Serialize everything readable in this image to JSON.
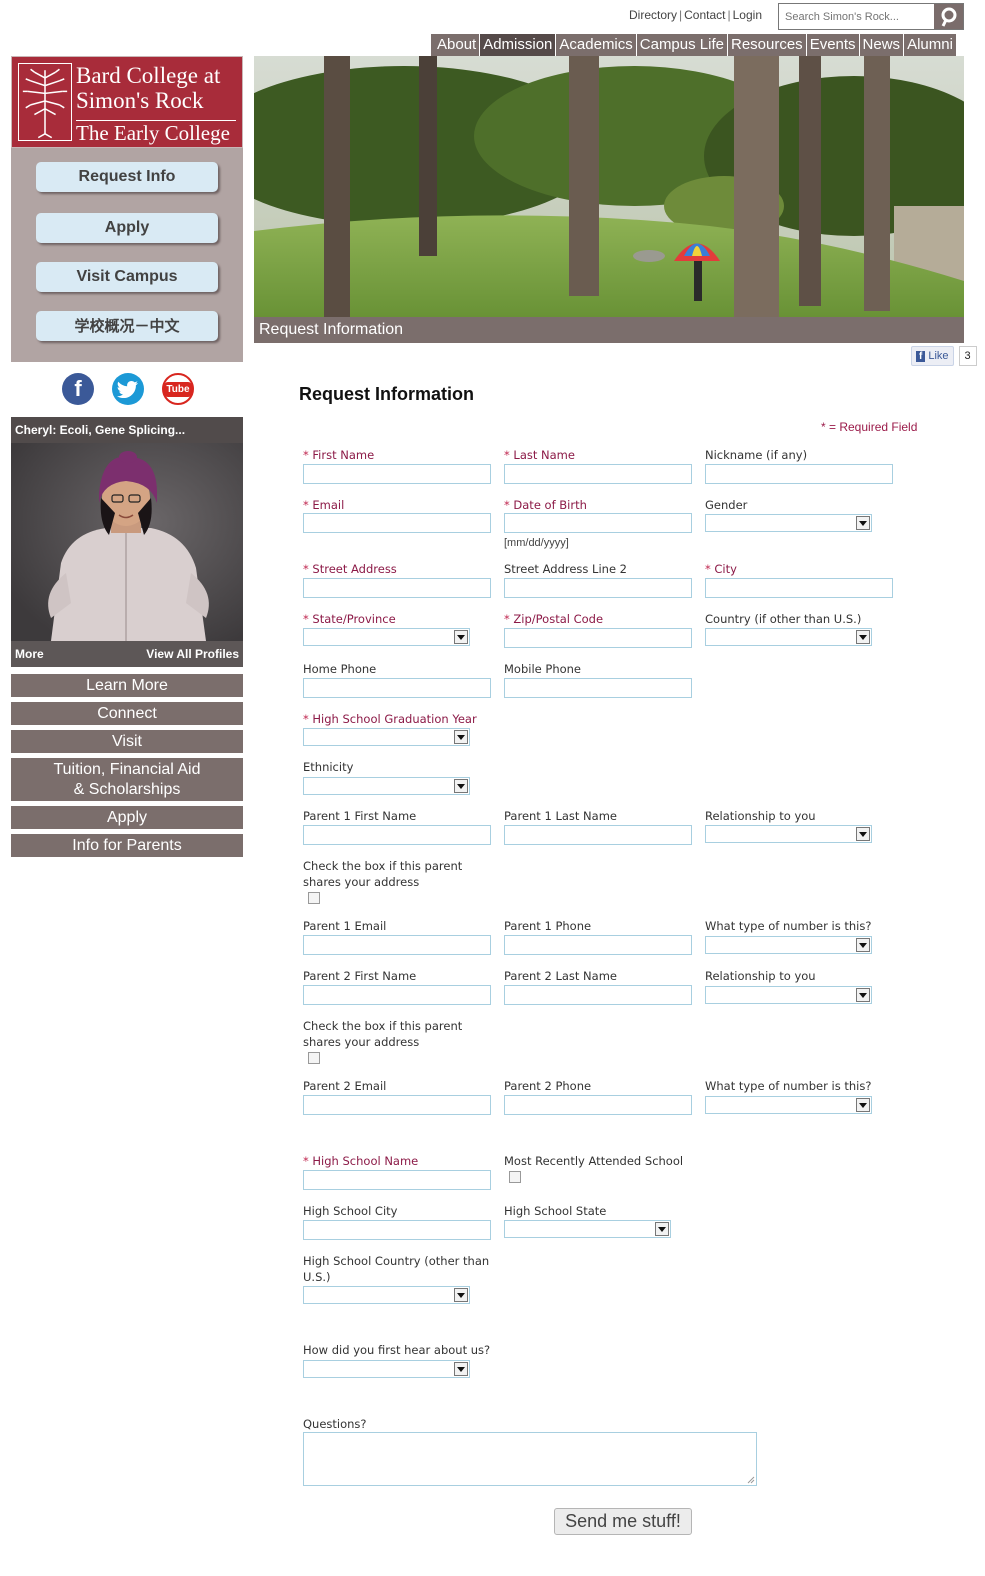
{
  "utility": {
    "directory": "Directory",
    "contact": "Contact",
    "login": "Login",
    "sep": "|"
  },
  "search": {
    "placeholder": "Search Simon's Rock...",
    "icon": "search-icon"
  },
  "topnav": [
    "About",
    "Admission",
    "Academics",
    "Campus Life",
    "Resources",
    "Events",
    "News",
    "Alumni"
  ],
  "topnav_active": "Admission",
  "logo": {
    "line1": "Bard College at",
    "line2": "Simon's Rock",
    "line3": "The Early College"
  },
  "side_buttons": [
    "Request Info",
    "Apply",
    "Visit Campus",
    "学校概况－中文"
  ],
  "social": {
    "facebook": "f",
    "youtube": "Tube"
  },
  "profile": {
    "caption": "Cheryl: Ecoli, Gene Splicing...",
    "more": "More",
    "view_all": "View All Profiles"
  },
  "left_nav": {
    "learn_more": "Learn More",
    "connect": "Connect",
    "visit": "Visit",
    "tuition_1": "Tuition, Financial Aid",
    "tuition_2": "& Scholarships",
    "apply": "Apply",
    "parents": "Info for Parents"
  },
  "hero": {
    "caption": "Request Information"
  },
  "fb": {
    "like": "Like",
    "count": "3"
  },
  "form": {
    "title": "Request Information",
    "required_note": "* = Required Field",
    "first_name": "First Name",
    "last_name": "Last Name",
    "nickname": "Nickname (if any)",
    "email": "Email",
    "dob": "Date of Birth",
    "dob_format": "[mm/dd/yyyy]",
    "gender": "Gender",
    "street": "Street Address",
    "street2": "Street Address Line 2",
    "city": "City",
    "state": "State/Province",
    "zip": "Zip/Postal Code",
    "country": "Country (if other than U.S.)",
    "home_phone": "Home Phone",
    "mobile_phone": "Mobile Phone",
    "grad_year": "High School Graduation Year",
    "ethnicity": "Ethnicity",
    "p1_first": "Parent 1 First Name",
    "p1_last": "Parent 1 Last Name",
    "p1_rel": "Relationship to you",
    "p1_shares_1": "Check the box if this parent",
    "p1_shares_2": "shares your address",
    "p1_email": "Parent 1 Email",
    "p1_phone": "Parent 1 Phone",
    "p1_numtype": "What type of number is this?",
    "p2_first": "Parent 2 First Name",
    "p2_last": "Parent 2 Last Name",
    "p2_rel": "Relationship to you",
    "p2_shares_1": "Check the box if this parent",
    "p2_shares_2": "shares your address",
    "p2_email": "Parent 2 Email",
    "p2_phone": "Parent 2 Phone",
    "p2_numtype": "What type of number is this?",
    "hs_name": "High School Name",
    "recent_school": "Most Recently Attended School",
    "hs_city": "High School City",
    "hs_state": "High School State",
    "hs_country_1": "High School Country (other than",
    "hs_country_2": "U.S.)",
    "hear": "How did you first hear about us?",
    "questions": "Questions?",
    "submit": "Send me stuff!"
  }
}
